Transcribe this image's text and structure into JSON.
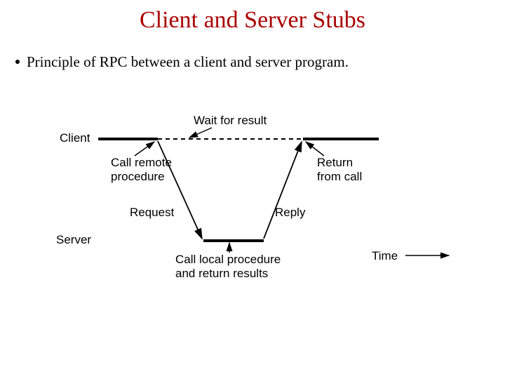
{
  "title": "Client and Server Stubs",
  "bullet": "Principle of RPC between a client and server program.",
  "labels": {
    "client": "Client",
    "server": "Server",
    "wait": "Wait for result",
    "call_remote_l1": "Call remote",
    "call_remote_l2": "procedure",
    "return_l1": "Return",
    "return_l2": "from call",
    "request": "Request",
    "reply": "Reply",
    "call_local_l1": "Call local procedure",
    "call_local_l2": "and return results",
    "time": "Time"
  }
}
